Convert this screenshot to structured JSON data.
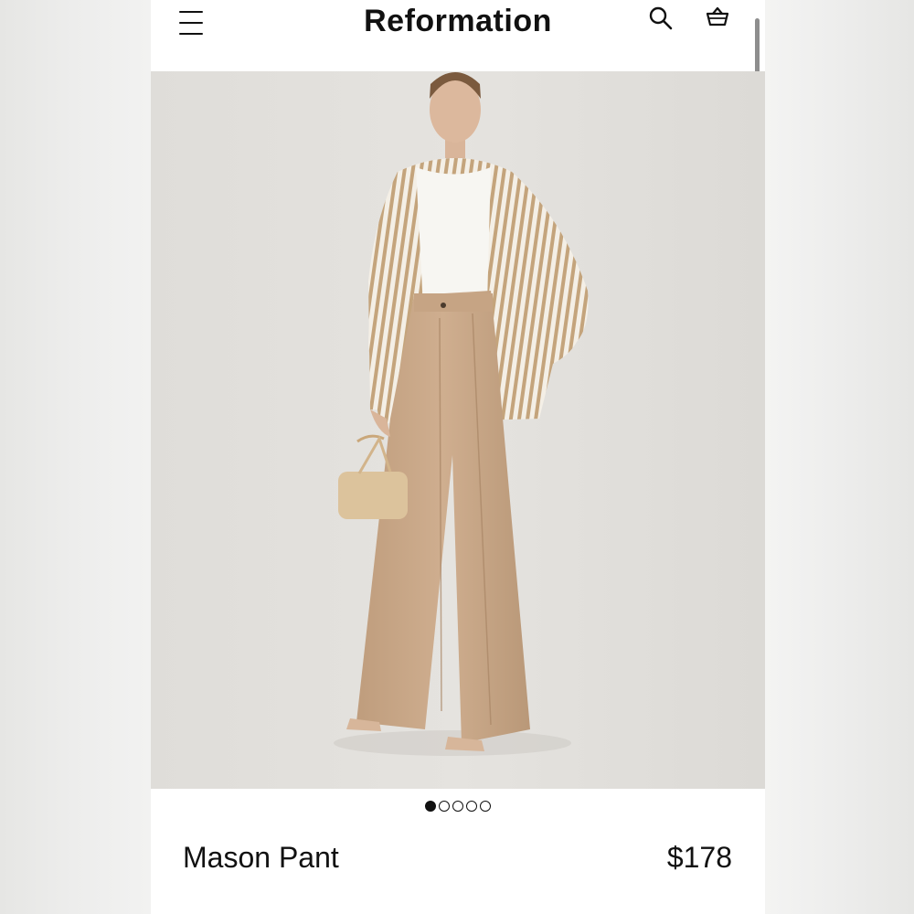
{
  "header": {
    "brand": "Reformation",
    "menu_icon": "hamburger-menu-icon",
    "search_icon": "search-icon",
    "cart_icon": "shopping-bag-icon"
  },
  "gallery": {
    "image_count": 5,
    "active_index": 1
  },
  "product": {
    "name": "Mason Pant",
    "price": "$178"
  },
  "colors": {
    "text": "#111111",
    "photo_background": "#e2e0dc",
    "pant": "#c9a888",
    "shirt_stripe": "#c4a47c"
  }
}
